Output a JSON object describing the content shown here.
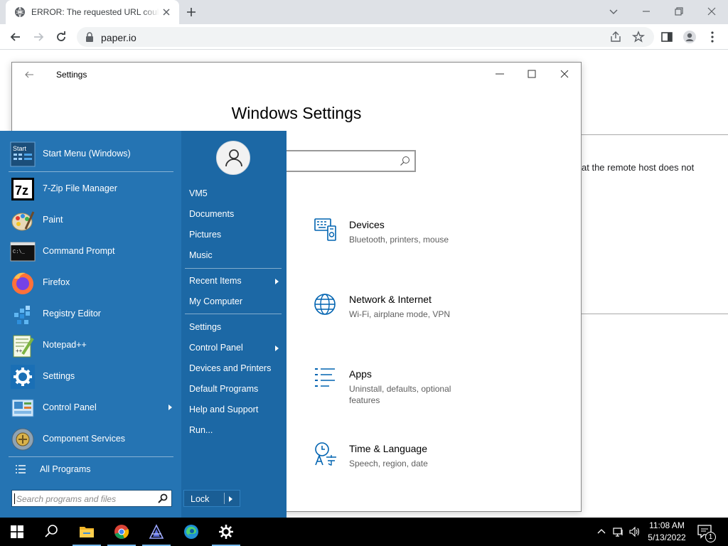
{
  "browser": {
    "tab_title": "ERROR: The requested URL could not be retrieved",
    "url": "paper.io",
    "page_text": "at the remote host does not"
  },
  "settings": {
    "window_title": "Settings",
    "heading": "Windows Settings",
    "categories": [
      {
        "title": "Devices",
        "subtitle": "Bluetooth, printers, mouse",
        "icon": "devices-icon"
      },
      {
        "title": "Network & Internet",
        "subtitle": "Wi-Fi, airplane mode, VPN",
        "icon": "globe-icon"
      },
      {
        "title": "Apps",
        "subtitle": "Uninstall, defaults, optional features",
        "icon": "apps-list-icon"
      },
      {
        "title": "Time & Language",
        "subtitle": "Speech, region, date",
        "icon": "time-language-icon"
      }
    ]
  },
  "start_menu": {
    "programs": [
      {
        "label": "Start Menu (Windows)",
        "icon": "start-menu-icon"
      },
      {
        "label": "7-Zip File Manager",
        "icon": "7zip-icon"
      },
      {
        "label": "Paint",
        "icon": "paint-icon"
      },
      {
        "label": "Command Prompt",
        "icon": "cmd-icon"
      },
      {
        "label": "Firefox",
        "icon": "firefox-icon"
      },
      {
        "label": "Registry Editor",
        "icon": "regedit-icon"
      },
      {
        "label": "Notepad++",
        "icon": "notepadpp-icon"
      },
      {
        "label": "Settings",
        "icon": "gear-icon"
      },
      {
        "label": "Control Panel",
        "icon": "control-panel-icon"
      },
      {
        "label": "Component Services",
        "icon": "component-services-icon"
      }
    ],
    "all_programs": "All Programs",
    "search_placeholder": "Search programs and files",
    "right_links": [
      {
        "label": "VM5"
      },
      {
        "label": "Documents"
      },
      {
        "label": "Pictures"
      },
      {
        "label": "Music"
      },
      {
        "label": "Recent Items"
      },
      {
        "label": "My Computer"
      },
      {
        "label": "Settings"
      },
      {
        "label": "Control Panel"
      },
      {
        "label": "Devices and Printers"
      },
      {
        "label": "Default Programs"
      },
      {
        "label": "Help and Support"
      },
      {
        "label": "Run..."
      }
    ],
    "lock_label": "Lock"
  },
  "taskbar": {
    "time": "11:08 AM",
    "date": "5/13/2022",
    "notification_count": "1",
    "pinned": [
      "windows-start-icon",
      "search-icon",
      "file-explorer-icon",
      "chrome-icon",
      "app-icon",
      "edge-icon",
      "gear-icon"
    ]
  },
  "colors": {
    "start_menu_bg": "#2574b3",
    "settings_accent": "#0063b1",
    "taskbar_bg": "#000000"
  }
}
